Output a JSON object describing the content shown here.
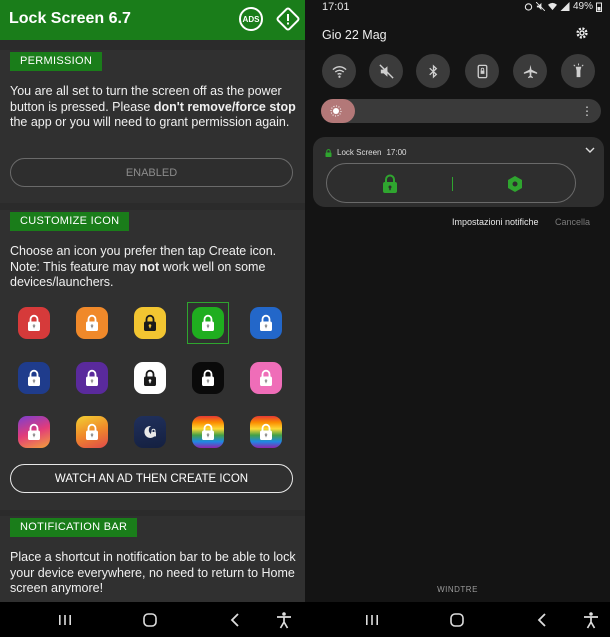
{
  "app": {
    "title": "Lock Screen 6.7",
    "ads_label": "ADS"
  },
  "permission": {
    "heading": "PERMISSION",
    "text_part1": "You are all set to turn the screen off as the power button is pressed. Please ",
    "text_bold": "don't remove/force stop",
    "text_part2": " the app or you will need to grant permission again.",
    "button_label": "ENABLED"
  },
  "customize": {
    "heading": "CUSTOMIZE ICON",
    "text_part1": "Choose an icon you prefer then tap Create icon. Note: This feature may ",
    "text_bold": "not",
    "text_part2": " work well on some devices/launchers.",
    "button_label": "WATCH AN AD THEN CREATE ICON",
    "selected_index": 3,
    "icons": [
      {
        "name": "red",
        "bg": "#d63a3a"
      },
      {
        "name": "orange",
        "bg": "#f0892a"
      },
      {
        "name": "yellow",
        "bg": "#f2c531"
      },
      {
        "name": "green",
        "bg": "#1fae1f"
      },
      {
        "name": "blue",
        "bg": "#2367c9"
      },
      {
        "name": "navy",
        "bg": "#1f3c8c"
      },
      {
        "name": "purple",
        "bg": "#5a2a9c"
      },
      {
        "name": "white",
        "bg": "#ffffff"
      },
      {
        "name": "black",
        "bg": "#0a0a0a"
      },
      {
        "name": "pink",
        "bg": "#ef6db8"
      },
      {
        "name": "sunset-gradient",
        "bg": "linear-gradient(160deg,#7b3fd0,#e23c7a,#f3a23a)"
      },
      {
        "name": "amber-gradient",
        "bg": "linear-gradient(160deg,#f2d033,#f08a2a,#e04a4a)"
      },
      {
        "name": "night-sky",
        "bg": "linear-gradient(170deg,#20305c,#142040)"
      },
      {
        "name": "rainbow",
        "bg": "linear-gradient(180deg,#e53935 0%,#fb8c00 20%,#fdd835 40%,#43a047 60%,#1e88e5 80%,#8e24aa 100%)"
      },
      {
        "name": "rainbow-2",
        "bg": "linear-gradient(180deg,#e53935 0%,#fb8c00 20%,#fdd835 40%,#43a047 60%,#1e88e5 80%,#8e24aa 100%)"
      }
    ]
  },
  "notification_bar": {
    "heading": "NOTIFICATION BAR",
    "text": "Place a shortcut in notification bar to be able to lock your device everywhere, no need to return to Home screen anymore!"
  },
  "shade": {
    "time": "17:01",
    "battery": "49%",
    "date": "Gio 22 Mag",
    "notif_app": "Lock Screen",
    "notif_time": "17:00",
    "action_settings": "Impostazioni notifiche",
    "action_cancel": "Cancella",
    "carrier": "WINDTRE"
  },
  "colors": {
    "accent": "#1a7d1a",
    "lock_green": "#2fa52f"
  }
}
